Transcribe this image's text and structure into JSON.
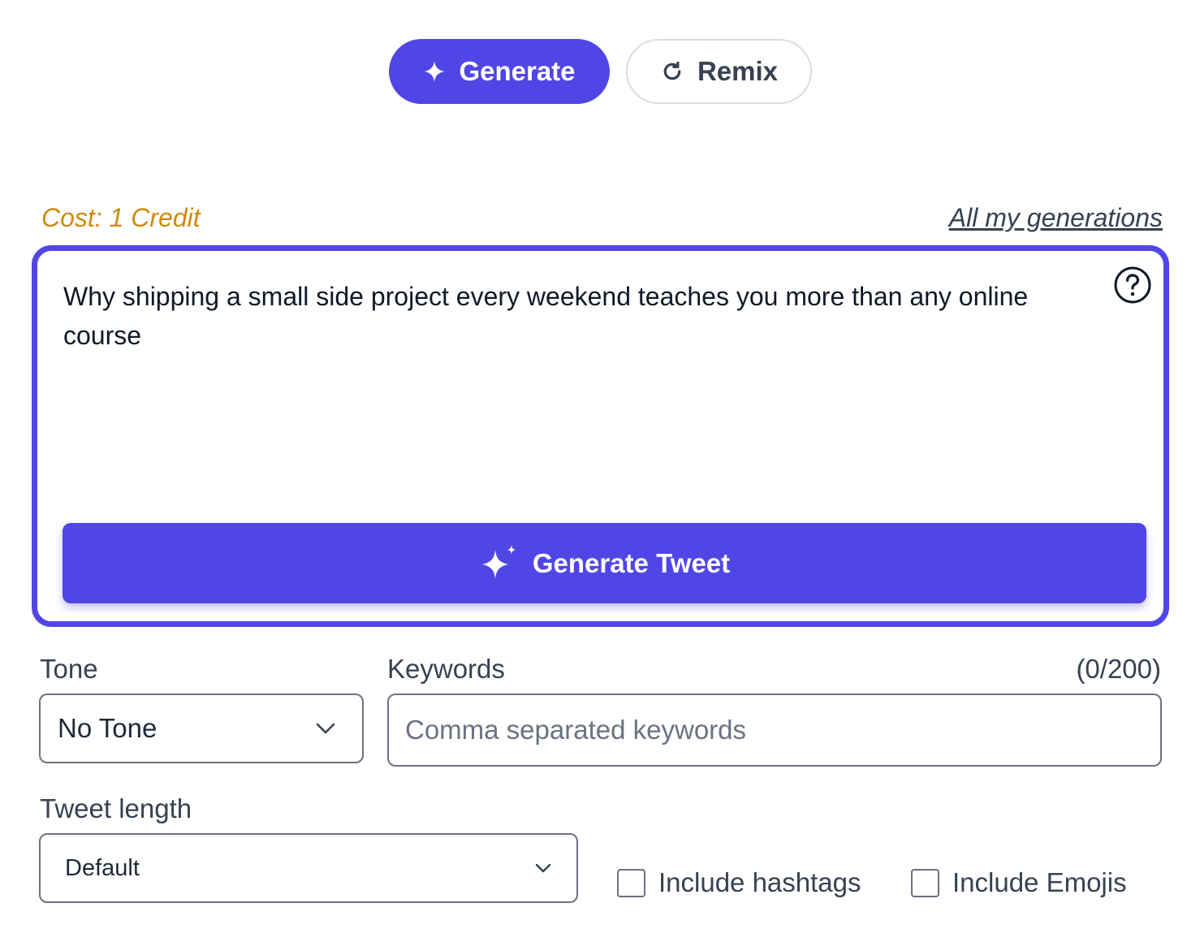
{
  "mode_toggle": {
    "generate_label": "Generate",
    "remix_label": "Remix"
  },
  "meta": {
    "cost_text": "Cost: 1 Credit",
    "all_generations_link": "All my generations"
  },
  "topic_input": {
    "value": "Why shipping a small side project every weekend teaches you more than any online course"
  },
  "generate_tweet_label": "Generate Tweet",
  "tone": {
    "label": "Tone",
    "selected": "No Tone"
  },
  "keywords": {
    "label": "Keywords",
    "counter": "(0/200)",
    "placeholder": "Comma separated keywords",
    "value": ""
  },
  "tweet_length": {
    "label": "Tweet length",
    "selected": "Default"
  },
  "options": {
    "hashtags_label": "Include hashtags",
    "hashtags_checked": false,
    "emojis_label": "Include Emojis",
    "emojis_checked": false
  },
  "colors": {
    "accent": "#5046e5",
    "cost": "#d08a0d"
  }
}
